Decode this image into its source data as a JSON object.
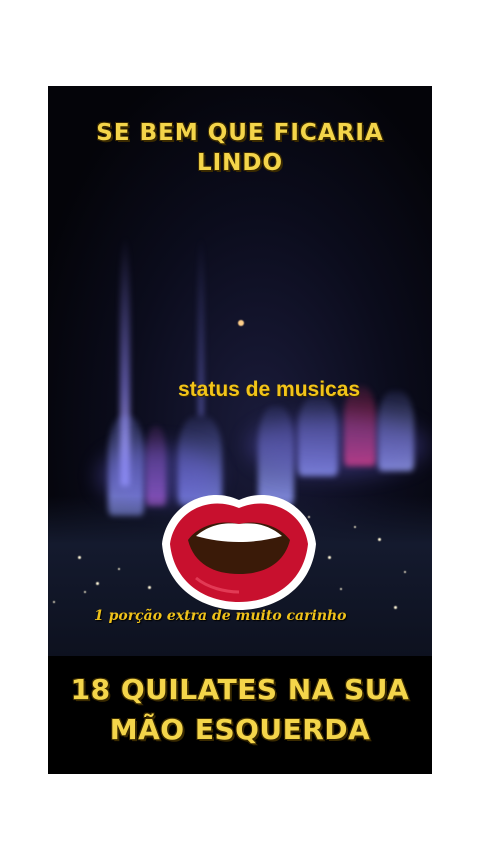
{
  "video": {
    "headline_top": [
      "SE BEM QUE FICARIA",
      "LINDO"
    ],
    "overlay_label": "status de musicas",
    "caption": "1 porção extra de muito carinho",
    "headline_bottom": [
      "18 QUILATES NA SUA",
      "MÃO ESQUERDA"
    ],
    "sticker_icon": "open-lips-icon",
    "colors": {
      "text_yellow": "#f4d54a",
      "lips_red": "#c8102e",
      "background": "#000000"
    }
  }
}
